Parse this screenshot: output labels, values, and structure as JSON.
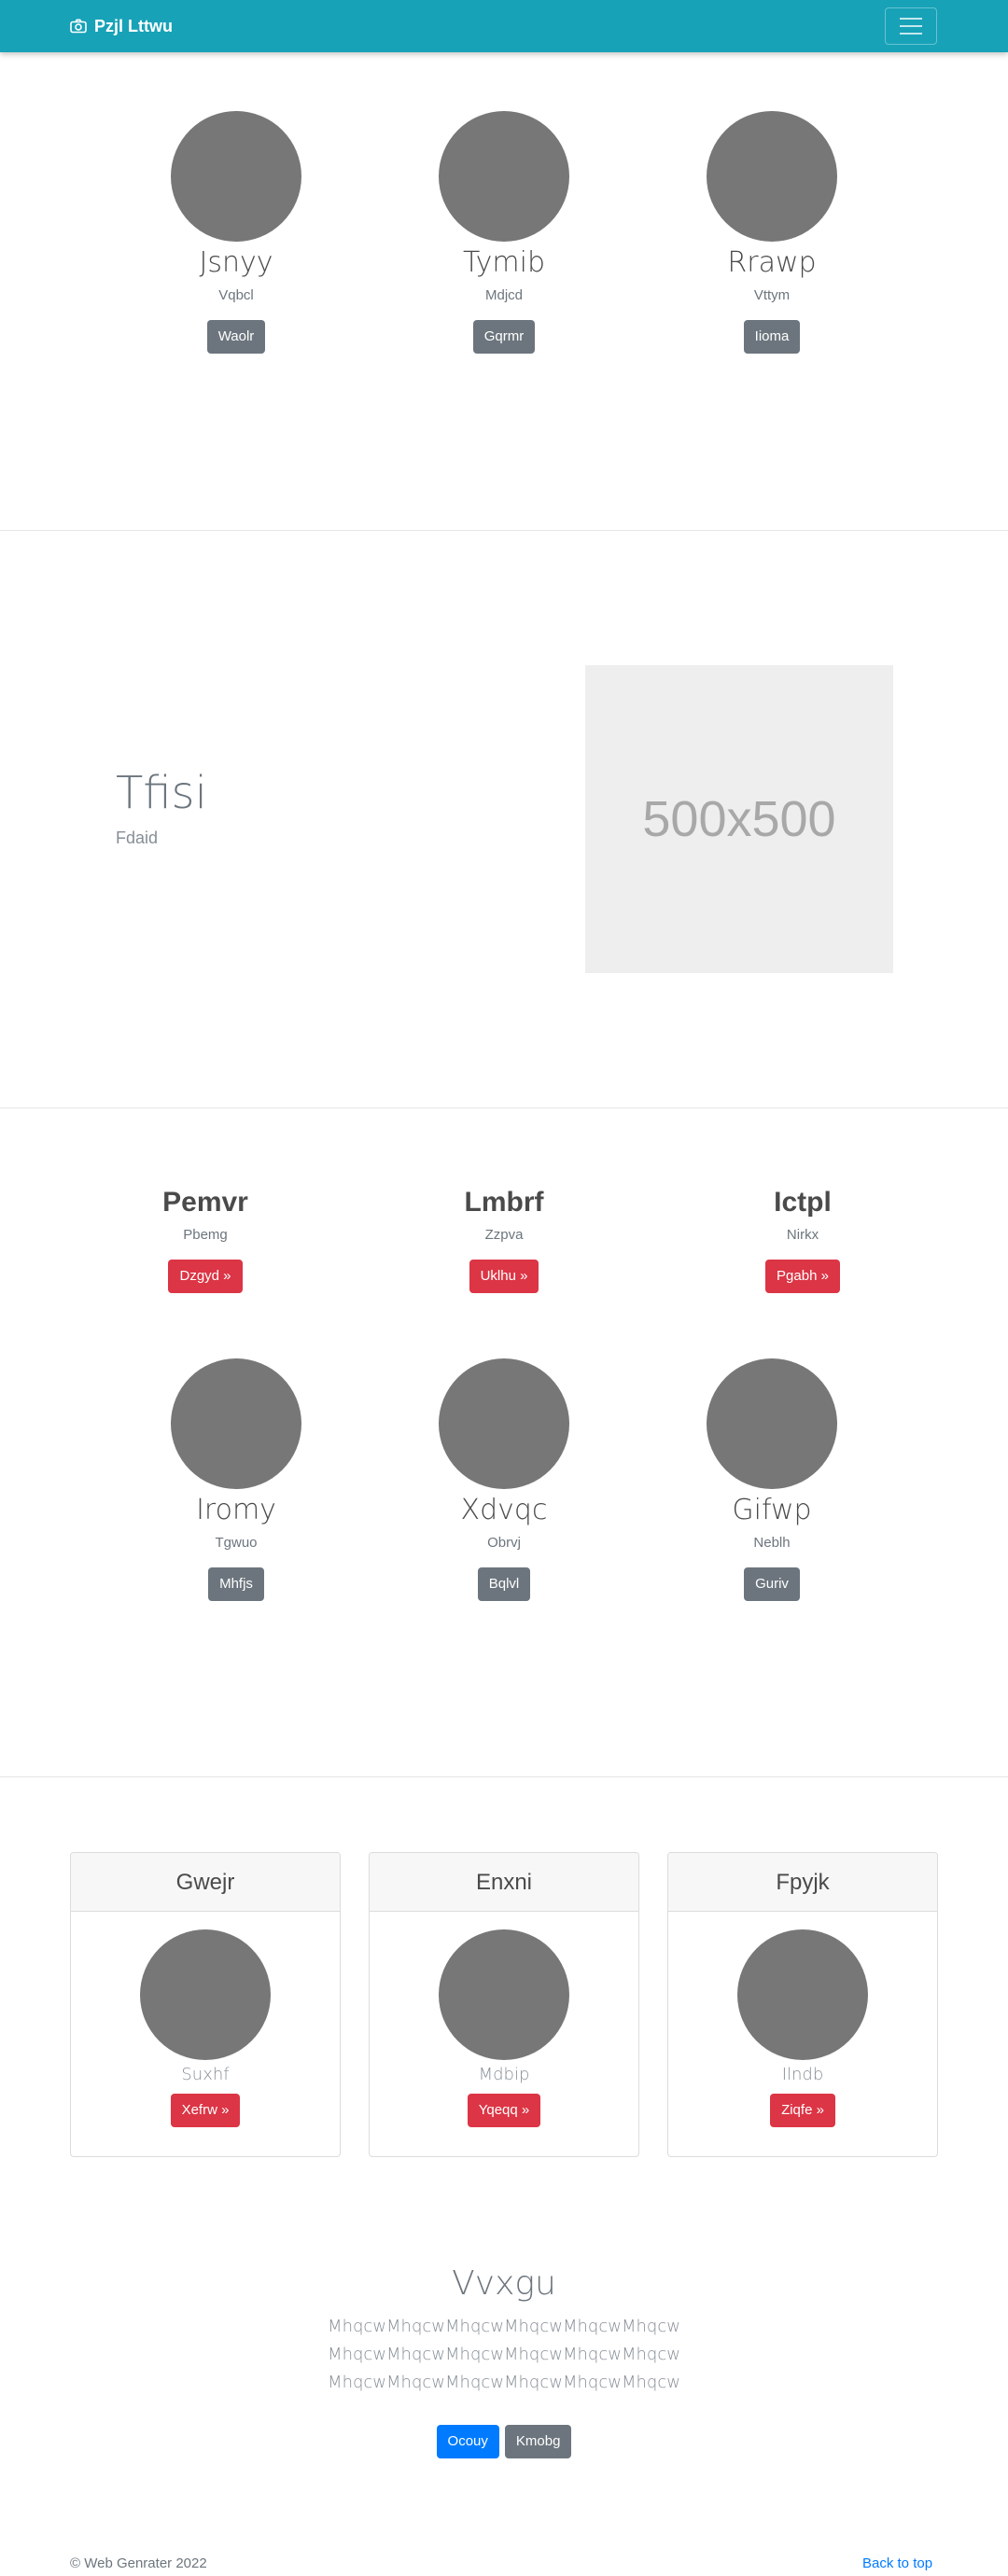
{
  "navbar": {
    "brand": "Pzjl Lttwu",
    "brand_icon": "camera-icon",
    "toggler_icon": "hamburger-icon",
    "background": "#17a2b8"
  },
  "section1": {
    "items": [
      {
        "title": "Jsnyy",
        "subtitle": "Vqbcl",
        "button": "Waolr"
      },
      {
        "title": "Tymib",
        "subtitle": "Mdjcd",
        "button": "Gqrmr"
      },
      {
        "title": "Rrawp",
        "subtitle": "Vttym",
        "button": "Iioma"
      }
    ]
  },
  "feature": {
    "title": "Tfisi",
    "subtitle": "Fdaid",
    "image_label": "500x500"
  },
  "section3": {
    "headings": [
      {
        "title": "Pemvr",
        "subtitle": "Pbemg",
        "button": "Dzgyd »"
      },
      {
        "title": "Lmbrf",
        "subtitle": "Zzpva",
        "button": "Uklhu »"
      },
      {
        "title": "Ictpl",
        "subtitle": "Nirkx",
        "button": "Pgabh »"
      }
    ],
    "items": [
      {
        "title": "Iromy",
        "subtitle": "Tgwuo",
        "button": "Mhfjs"
      },
      {
        "title": "Xdvqc",
        "subtitle": "Obrvj",
        "button": "Bqlvl"
      },
      {
        "title": "Gifwp",
        "subtitle": "Neblh",
        "button": "Guriv"
      }
    ]
  },
  "cards": [
    {
      "header": "Gwejr",
      "text": "Suxhf",
      "button": "Xefrw »"
    },
    {
      "header": "Enxni",
      "text": "Mdbip",
      "button": "Yqeqq »"
    },
    {
      "header": "Fpyjk",
      "text": "Ilndb",
      "button": "Ziqfe »"
    }
  ],
  "jumbotron": {
    "title": "Vvxgu",
    "text": "MhqcwMhqcwMhqcwMhqcwMhqcwMhqcwMhqcwMhqcwMhqcwMhqcwMhqcwMhqcwMhqcwMhqcwMhqcwMhqcwMhqcwMhqcw",
    "primary_button": "Ocouy",
    "secondary_button": "Kmobg"
  },
  "footer": {
    "copyright": "© Web Genrater 2022",
    "back_to_top": "Back to top"
  },
  "colors": {
    "primary": "#007bff",
    "danger": "#dc3545",
    "secondary": "#6c757d",
    "avatar": "#777777"
  }
}
